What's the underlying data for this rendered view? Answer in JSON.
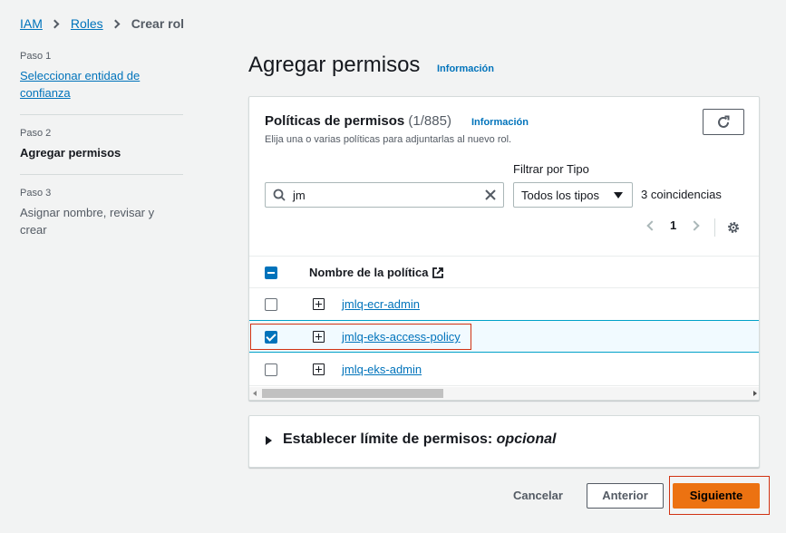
{
  "breadcrumb": {
    "items": [
      "IAM",
      "Roles"
    ],
    "current": "Crear rol"
  },
  "steps": [
    {
      "num": "Paso 1",
      "title": "Seleccionar entidad de confianza"
    },
    {
      "num": "Paso 2",
      "title": "Agregar permisos"
    },
    {
      "num": "Paso 3",
      "title": "Asignar nombre, revisar y crear"
    }
  ],
  "header": {
    "title": "Agregar permisos",
    "info": "Información"
  },
  "policies": {
    "title": "Políticas de permisos",
    "count": "(1/885)",
    "info": "Información",
    "description": "Elija una o varias políticas para adjuntarlas al nuevo rol.",
    "search_value": "jm",
    "filter_label": "Filtrar por Tipo",
    "filter_value": "Todos los tipos",
    "matches": "3 coincidencias",
    "page": "1",
    "column_header": "Nombre de la política",
    "rows": [
      {
        "name": "jmlq-ecr-admin",
        "checked": false
      },
      {
        "name": "jmlq-eks-access-policy",
        "checked": true
      },
      {
        "name": "jmlq-eks-admin",
        "checked": false
      }
    ]
  },
  "boundary": {
    "title": "Establecer límite de permisos: ",
    "optional": "opcional"
  },
  "footer": {
    "cancel": "Cancelar",
    "previous": "Anterior",
    "next": "Siguiente"
  },
  "colors": {
    "link": "#0073bb",
    "primary_button": "#ec7211",
    "highlight": "#d13212"
  }
}
